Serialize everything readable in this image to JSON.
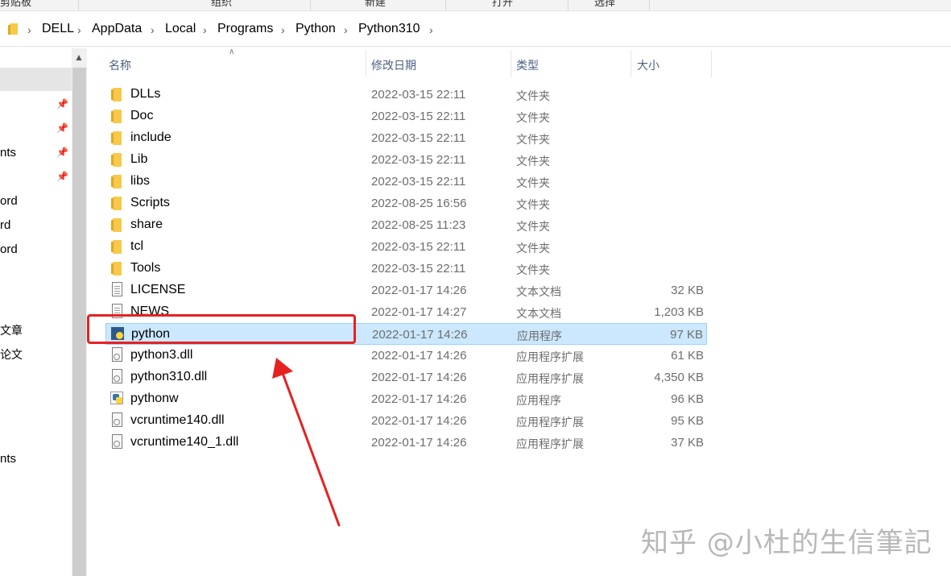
{
  "ribbon": {
    "clipboard": "剪贴板",
    "organize": "组织",
    "new": "新建",
    "open": "打开",
    "select": "选择"
  },
  "breadcrumb": [
    "DELL",
    "AppData",
    "Local",
    "Programs",
    "Python",
    "Python310"
  ],
  "left_pane": {
    "items": [
      "nts",
      "ord",
      "rd",
      "ord",
      "文章",
      "论文",
      "nts"
    ]
  },
  "columns": {
    "name": "名称",
    "modified": "修改日期",
    "type": "类型",
    "size": "大小"
  },
  "files": [
    {
      "name": "DLLs",
      "date": "2022-03-15 22:11",
      "type": "文件夹",
      "size": "",
      "icon": "folder-icon"
    },
    {
      "name": "Doc",
      "date": "2022-03-15 22:11",
      "type": "文件夹",
      "size": "",
      "icon": "folder-icon"
    },
    {
      "name": "include",
      "date": "2022-03-15 22:11",
      "type": "文件夹",
      "size": "",
      "icon": "folder-icon"
    },
    {
      "name": "Lib",
      "date": "2022-03-15 22:11",
      "type": "文件夹",
      "size": "",
      "icon": "folder-icon"
    },
    {
      "name": "libs",
      "date": "2022-03-15 22:11",
      "type": "文件夹",
      "size": "",
      "icon": "folder-icon"
    },
    {
      "name": "Scripts",
      "date": "2022-08-25 16:56",
      "type": "文件夹",
      "size": "",
      "icon": "folder-icon"
    },
    {
      "name": "share",
      "date": "2022-08-25 11:23",
      "type": "文件夹",
      "size": "",
      "icon": "folder-icon"
    },
    {
      "name": "tcl",
      "date": "2022-03-15 22:11",
      "type": "文件夹",
      "size": "",
      "icon": "folder-icon"
    },
    {
      "name": "Tools",
      "date": "2022-03-15 22:11",
      "type": "文件夹",
      "size": "",
      "icon": "folder-icon"
    },
    {
      "name": "LICENSE",
      "date": "2022-01-17 14:26",
      "type": "文本文档",
      "size": "32 KB",
      "icon": "text-document-icon"
    },
    {
      "name": "NEWS",
      "date": "2022-01-17 14:27",
      "type": "文本文档",
      "size": "1,203 KB",
      "icon": "text-document-icon"
    },
    {
      "name": "python",
      "date": "2022-01-17 14:26",
      "type": "应用程序",
      "size": "97 KB",
      "icon": "python-exe-icon"
    },
    {
      "name": "python3.dll",
      "date": "2022-01-17 14:26",
      "type": "应用程序扩展",
      "size": "61 KB",
      "icon": "dll-icon"
    },
    {
      "name": "python310.dll",
      "date": "2022-01-17 14:26",
      "type": "应用程序扩展",
      "size": "4,350 KB",
      "icon": "dll-icon"
    },
    {
      "name": "pythonw",
      "date": "2022-01-17 14:26",
      "type": "应用程序",
      "size": "96 KB",
      "icon": "pythonw-exe-icon"
    },
    {
      "name": "vcruntime140.dll",
      "date": "2022-01-17 14:26",
      "type": "应用程序扩展",
      "size": "95 KB",
      "icon": "dll-icon"
    },
    {
      "name": "vcruntime140_1.dll",
      "date": "2022-01-17 14:26",
      "type": "应用程序扩展",
      "size": "37 KB",
      "icon": "dll-icon"
    }
  ],
  "selected_file": "python",
  "annotation": {
    "highlight_color": "#e52222"
  },
  "watermark": "知乎 @小杜的生信筆記"
}
